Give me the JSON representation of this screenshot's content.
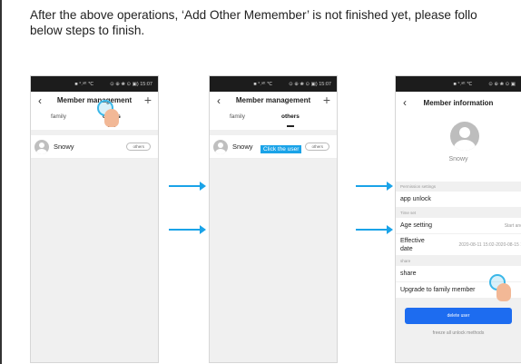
{
  "instruction": {
    "line1": "After the above operations, ‘Add Other Memember’ is not finished yet, please follo",
    "line2": "below steps to finish."
  },
  "phone1": {
    "status": "■ °.ᵃᵗᵗ ℃",
    "status_right": "⊙ ⊕ ❀ ⊙ ▣) 15:07",
    "title": "Member management",
    "tabs": [
      "family",
      "others"
    ],
    "user": "Snowy",
    "pill": "others"
  },
  "phone2": {
    "status": "■ °.ᵃᵗᵗ ℃",
    "status_right": "⊙ ⊕ ❀ ⊙ ▣) 15:07",
    "title": "Member management",
    "tabs": [
      "family",
      "others"
    ],
    "user": "Snowy",
    "pill": "others",
    "tooltip": "Click the user"
  },
  "phone3": {
    "status": "■ °.ᵃᵗᵗ ℃",
    "status_right": "⊙ ⊕ ❀ ⊙ ▣",
    "title": "Member information",
    "name": "Snowy",
    "sec_permission": "Permission settings",
    "app_unlock": "app unlock",
    "sec_time": "Time set",
    "age_setting": "Age setting",
    "age_value": "Start and",
    "effective_label_1": "Effective",
    "effective_label_2": "date",
    "effective_value": "2020-08-11 15:02-2020-08-15 1",
    "sec_share": "share",
    "share": "share",
    "upgrade": "Upgrade to family member",
    "delete": "delete user",
    "freeze": "freeze all unlock methods"
  },
  "colors": {
    "accent": "#1aa3e8",
    "button": "#1d6cf0"
  }
}
